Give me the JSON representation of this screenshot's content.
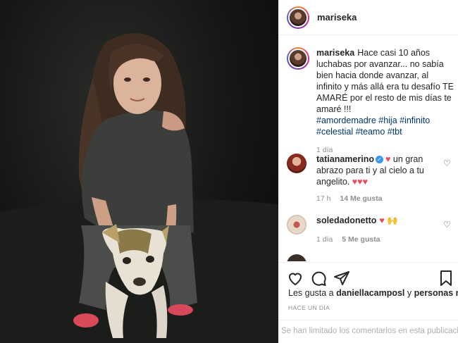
{
  "header": {
    "username": "mariseka"
  },
  "caption": {
    "username": "mariseka",
    "text": "Hace casi 10 años luchabas por avanzar... no sabía bien hacia donde avanzar, al infinito y más allá era tu desafío TE AMARÉ por el resto de mis días te amaré !!!",
    "hashtags_line1": "#amordemadre #hija #infinito",
    "hashtags_line2": "#celestial #teamo #tbt",
    "time": "1 día"
  },
  "comments": [
    {
      "username": "tatianamerino",
      "text_part1": "un gran",
      "text_part2": "abrazo para ti y al cielo a tu",
      "text_part3": "angelito.",
      "time": "17 h",
      "likes": "14 Me gusta"
    },
    {
      "username": "soledadonetto",
      "time": "1 día",
      "likes": "5 Me gusta"
    }
  ],
  "actions": {
    "likes_prefix": "Les gusta a",
    "liker": "daniellacamposl",
    "conjunction": "y",
    "others": "personas más",
    "timestamp": "Hace un día",
    "comments_limited": "Se han limitado los comentarios en esta publicación"
  },
  "icons": {
    "like": "heart-outline-icon",
    "comment": "speech-bubble-icon",
    "share": "paper-plane-icon",
    "save": "bookmark-icon",
    "verified": "verified-badge-icon"
  },
  "colors": {
    "text": "#262626",
    "muted": "#8e8e8e",
    "hashtag": "#00376b",
    "heart": "#ed4956",
    "verified": "#3897f0"
  }
}
